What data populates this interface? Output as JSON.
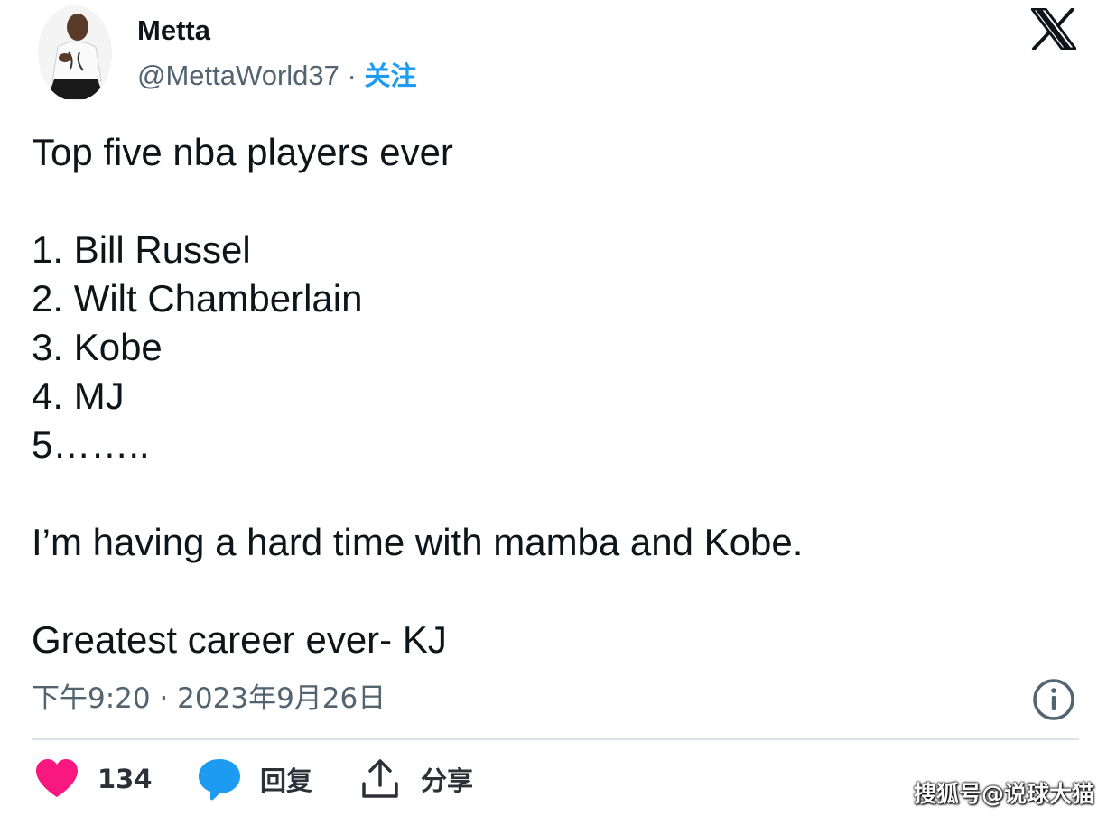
{
  "header": {
    "display_name": "Metta",
    "handle": "@MettaWorld37",
    "separator": " · ",
    "follow_label": "关注",
    "avatar_icon": "avatar-photo",
    "logo_icon": "x-logo-icon"
  },
  "tweet": {
    "lines": [
      "Top five nba players ever",
      "",
      "1. Bill Russel",
      "2. Wilt Chamberlain",
      "3. Kobe",
      "4. MJ",
      "5……..",
      "",
      "I’m having a hard time with mamba and Kobe.",
      "",
      "Greatest career ever- KJ"
    ],
    "timestamp": "下午9:20 · 2023年9月26日"
  },
  "actions": {
    "like_count": "134",
    "reply_label": "回复",
    "share_label": "分享"
  },
  "watermark": "搜狐号@说球大猫",
  "colors": {
    "link": "#1d9bf0",
    "secondary_text": "#536471",
    "like": "#f91880",
    "reply": "#1d9bf0",
    "primary_text": "#0f1419"
  }
}
